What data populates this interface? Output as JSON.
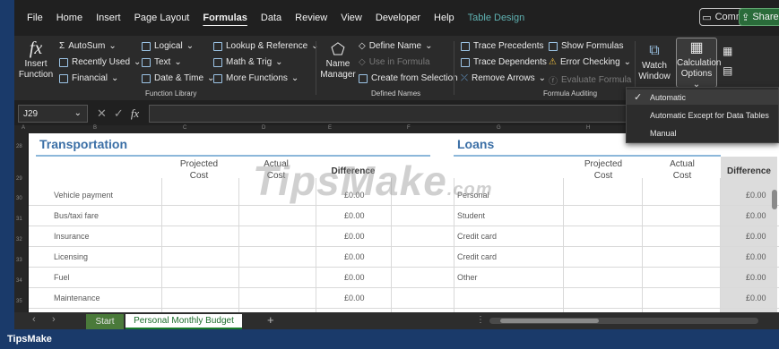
{
  "menu": [
    "File",
    "Home",
    "Insert",
    "Page Layout",
    "Formulas",
    "Data",
    "Review",
    "View",
    "Developer",
    "Help",
    "Table Design"
  ],
  "header_buttons": {
    "comments": "Comments",
    "share": "Share"
  },
  "ribbon": {
    "insert_function": [
      "Insert",
      "Function"
    ],
    "autosum": "AutoSum",
    "recently_used": "Recently Used",
    "financial": "Financial",
    "logical": "Logical",
    "text": "Text",
    "date_time": "Date & Time",
    "lookup": "Lookup & Reference",
    "math_trig": "Math & Trig",
    "more_functions": "More Functions",
    "function_library": "Function Library",
    "name_manager": [
      "Name",
      "Manager"
    ],
    "define_name": "Define Name",
    "use_in_formula": "Use in Formula",
    "create_from_selection": "Create from Selection",
    "defined_names": "Defined Names",
    "trace_precedents": "Trace Precedents",
    "trace_dependents": "Trace Dependents",
    "remove_arrows": "Remove Arrows",
    "show_formulas": "Show Formulas",
    "error_checking": "Error Checking",
    "evaluate_formula": "Evaluate Formula",
    "formula_auditing": "Formula Auditing",
    "watch_window": [
      "Watch",
      "Window"
    ],
    "calculation_options": [
      "Calculation",
      "Options"
    ]
  },
  "name_box": "J29",
  "column_letters": [
    "A",
    "B",
    "C",
    "D",
    "E",
    "F",
    "G",
    "H"
  ],
  "row_numbers": [
    "28",
    "29",
    "30",
    "31",
    "32",
    "33",
    "34",
    "35"
  ],
  "sheet": {
    "transportation": {
      "title": "Transportation",
      "headers": {
        "projected": [
          "Projected",
          "Cost"
        ],
        "actual": [
          "Actual",
          "Cost"
        ],
        "difference": "Difference"
      },
      "rows": [
        {
          "label": "Vehicle payment",
          "difference": "£0.00"
        },
        {
          "label": "Bus/taxi fare",
          "difference": "£0.00"
        },
        {
          "label": "Insurance",
          "difference": "£0.00"
        },
        {
          "label": "Licensing",
          "difference": "£0.00"
        },
        {
          "label": "Fuel",
          "difference": "£0.00"
        },
        {
          "label": "Maintenance",
          "difference": "£0.00"
        }
      ]
    },
    "loans": {
      "title": "Loans",
      "headers": {
        "projected": [
          "Projected",
          "Cost"
        ],
        "actual": [
          "Actual",
          "Cost"
        ],
        "difference": "Difference"
      },
      "rows": [
        {
          "label": "Personal",
          "difference": "£0.00"
        },
        {
          "label": "Student",
          "difference": "£0.00"
        },
        {
          "label": "Credit card",
          "difference": "£0.00"
        },
        {
          "label": "Credit card",
          "difference": "£0.00"
        },
        {
          "label": "Other",
          "difference": "£0.00"
        },
        {
          "label": "",
          "difference": "£0.00"
        }
      ]
    }
  },
  "watermark": {
    "main": "TipsMake",
    "suffix": ".com"
  },
  "tabs": {
    "start": "Start",
    "active": "Personal Monthly Budget"
  },
  "calculation_menu": {
    "items": [
      "Automatic",
      "Automatic Except for Data Tables",
      "Manual"
    ],
    "checked": "Automatic"
  },
  "footer_brand": "TipsMake",
  "colors": {
    "accent_green": "#2a6c3a",
    "table_title": "#3b6fa6",
    "context_tab": "#5fb2b2",
    "footer": "#1a3a6a"
  }
}
